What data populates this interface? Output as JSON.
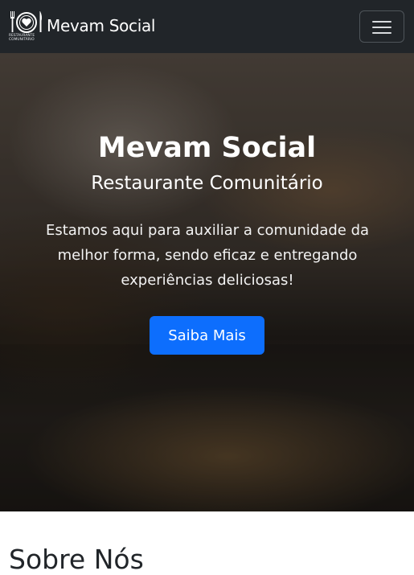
{
  "navbar": {
    "brand_name": "Mevam Social",
    "logo_text_line1": "RESTAURANTE",
    "logo_text_line2": "COMUNITÁRIO",
    "menu_icon": "hamburger-menu-icon"
  },
  "hero": {
    "title": "Mevam Social",
    "subtitle": "Restaurante Comunitário",
    "text": "Estamos aqui para auxiliar a comunidade da melhor forma, sendo eficaz e entregando experiências deliciosas!",
    "button_label": "Saiba Mais",
    "button_color": "#0d6efd"
  },
  "about": {
    "title": "Sobre Nós"
  },
  "colors": {
    "navbar_bg": "#212529",
    "text_light": "#ffffff"
  }
}
